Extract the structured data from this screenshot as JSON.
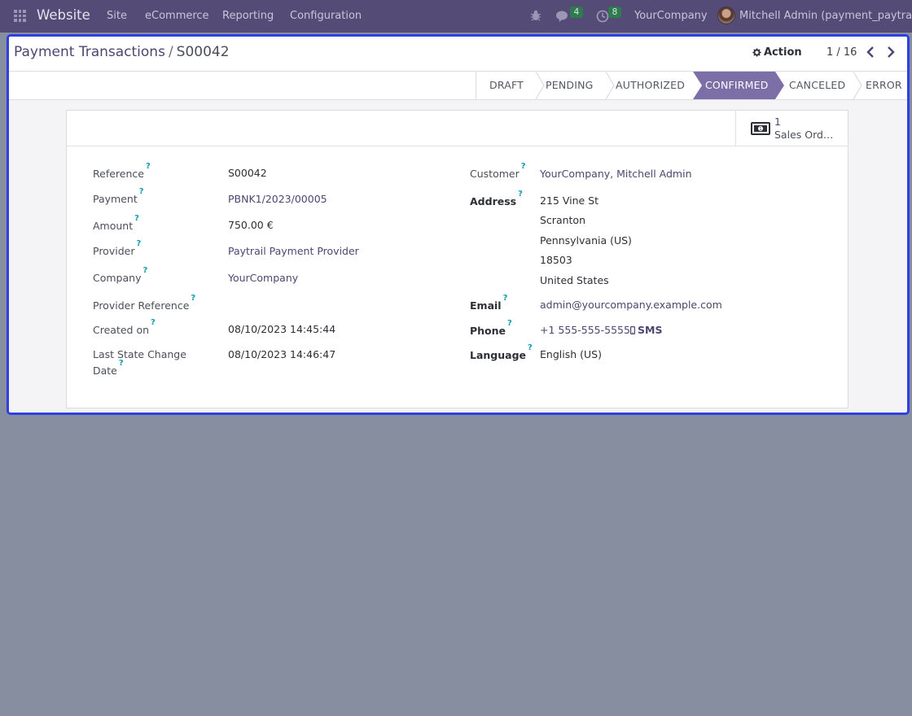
{
  "navbar": {
    "brand": "Website",
    "menu": [
      "Site",
      "eCommerce",
      "Reporting",
      "Configuration"
    ],
    "messages_count": "4",
    "activities_count": "8",
    "company": "YourCompany",
    "user": "Mitchell Admin (payment_paytrail)"
  },
  "control_panel": {
    "breadcrumb_parent": "Payment Transactions",
    "breadcrumb_separator": "/",
    "breadcrumb_current": "S00042",
    "action_label": "Action",
    "pager_value": "1 / 16"
  },
  "statusbar": {
    "stages": [
      "DRAFT",
      "PENDING",
      "AUTHORIZED",
      "CONFIRMED",
      "CANCELED",
      "ERROR"
    ],
    "active_stage": "CONFIRMED",
    "active_color": "#7c6fa8"
  },
  "smart_button": {
    "count": "1",
    "label": "Sales Ord…"
  },
  "left_fields": [
    {
      "label": "Reference",
      "value": "S00042"
    },
    {
      "label": "Payment",
      "value": "PBNK1/2023/00005"
    },
    {
      "label": "Amount",
      "value": "750.00 €"
    },
    {
      "label": "Provider",
      "value": "Paytrail Payment Provider"
    },
    {
      "label": "Company",
      "value": "YourCompany"
    },
    {
      "label": "Provider Reference",
      "value": ""
    },
    {
      "label": "Created on",
      "value": "08/10/2023 14:45:44"
    },
    {
      "label_line1": "Last State Change",
      "label_line2": "Date",
      "value": "08/10/2023 14:46:47"
    }
  ],
  "right_fields": {
    "customer_label": "Customer",
    "customer_value": "YourCompany, Mitchell Admin",
    "address_label": "Address",
    "address_lines": [
      "215 Vine St",
      "Scranton",
      "Pennsylvania (US)",
      "18503",
      "United States"
    ],
    "email_label": "Email",
    "email_value": "admin@yourcompany.example.com",
    "phone_label": "Phone",
    "phone_value": "+1 555-555-5555",
    "sms_label": "SMS",
    "language_label": "Language",
    "language_value": "English (US)"
  },
  "help_mark": "?",
  "colors": {
    "navbar_bg": "#544c76",
    "link": "#4c4670",
    "help": "#0f9bb0",
    "focus_border": "#2f3fe0",
    "badge_bg": "#2f7a4e",
    "backdrop": "#878ea0"
  }
}
